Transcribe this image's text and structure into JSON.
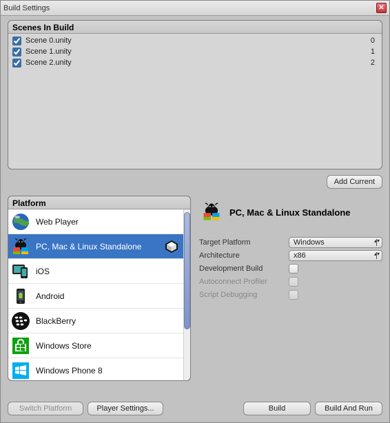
{
  "window": {
    "title": "Build Settings"
  },
  "scenes": {
    "header": "Scenes In Build",
    "items": [
      {
        "name": "Scene 0.unity",
        "checked": true,
        "index": "0"
      },
      {
        "name": "Scene 1.unity",
        "checked": true,
        "index": "1"
      },
      {
        "name": "Scene 2.unity",
        "checked": true,
        "index": "2"
      }
    ],
    "add_current": "Add Current"
  },
  "platform": {
    "header": "Platform",
    "items": [
      {
        "label": "Web Player",
        "icon": "web-player-icon",
        "selected": false
      },
      {
        "label": "PC, Mac & Linux Standalone",
        "icon": "standalone-icon",
        "selected": true
      },
      {
        "label": "iOS",
        "icon": "ios-icon",
        "selected": false
      },
      {
        "label": "Android",
        "icon": "android-icon",
        "selected": false
      },
      {
        "label": "BlackBerry",
        "icon": "blackberry-icon",
        "selected": false
      },
      {
        "label": "Windows Store",
        "icon": "windows-store-icon",
        "selected": false
      },
      {
        "label": "Windows Phone 8",
        "icon": "windows-phone-icon",
        "selected": false
      }
    ]
  },
  "details": {
    "title": "PC, Mac & Linux Standalone",
    "fields": {
      "target_platform": {
        "label": "Target Platform",
        "value": "Windows"
      },
      "architecture": {
        "label": "Architecture",
        "value": "x86"
      },
      "development_build": {
        "label": "Development Build",
        "checked": false
      },
      "autoconnect_profiler": {
        "label": "Autoconnect Profiler",
        "checked": false,
        "disabled": true
      },
      "script_debugging": {
        "label": "Script Debugging",
        "checked": false,
        "disabled": true
      }
    }
  },
  "buttons": {
    "switch_platform": "Switch Platform",
    "player_settings": "Player Settings...",
    "build": "Build",
    "build_and_run": "Build And Run"
  },
  "colors": {
    "selection": "#3a75c4",
    "panel_bg": "#c2c2c2"
  }
}
